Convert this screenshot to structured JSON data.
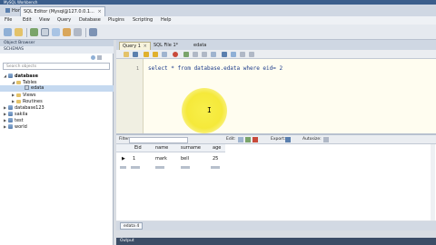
{
  "window": {
    "title": "MySQL Workbench"
  },
  "tabs": [
    {
      "label": "Home"
    },
    {
      "label": "SQL Editor (Mysql@127.0.0.1..."
    }
  ],
  "menu": [
    "File",
    "Edit",
    "View",
    "Query",
    "Database",
    "Plugins",
    "Scripting",
    "Help"
  ],
  "sidebar": {
    "header": "Object Browser",
    "subheader": "SCHEMAS",
    "search_placeholder": "Search objects",
    "tree": [
      {
        "label": "database",
        "level": 0,
        "icon": "db",
        "expanded": true,
        "bold": true
      },
      {
        "label": "Tables",
        "level": 1,
        "icon": "folder",
        "expanded": true
      },
      {
        "label": "edata",
        "level": 2,
        "icon": "table",
        "selected": true
      },
      {
        "label": "Views",
        "level": 1,
        "icon": "folder"
      },
      {
        "label": "Routines",
        "level": 1,
        "icon": "folder"
      },
      {
        "label": "database123",
        "level": 0,
        "icon": "db"
      },
      {
        "label": "sakila",
        "level": 0,
        "icon": "db"
      },
      {
        "label": "test",
        "level": 0,
        "icon": "db"
      },
      {
        "label": "world",
        "level": 0,
        "icon": "db"
      }
    ]
  },
  "editor": {
    "tabs": [
      {
        "label": "Query 1",
        "active": true
      },
      {
        "label": "SQL File 1*"
      },
      {
        "label": "edata"
      }
    ],
    "line_number": "1",
    "code": "select * from database.edata where eid= 2",
    "highlight_color": "#f5e93a"
  },
  "results": {
    "filter_label": "Filter:",
    "toolbar": [
      "Edit:",
      "Export:",
      "Autosize:"
    ],
    "columns": [
      "Eid",
      "name",
      "surname",
      "age"
    ],
    "rows": [
      {
        "marker": "▶",
        "cells": [
          "1",
          "mark",
          "bell",
          "25"
        ]
      }
    ],
    "bottom_tab": "edata 4"
  },
  "output": {
    "label": "Output"
  }
}
